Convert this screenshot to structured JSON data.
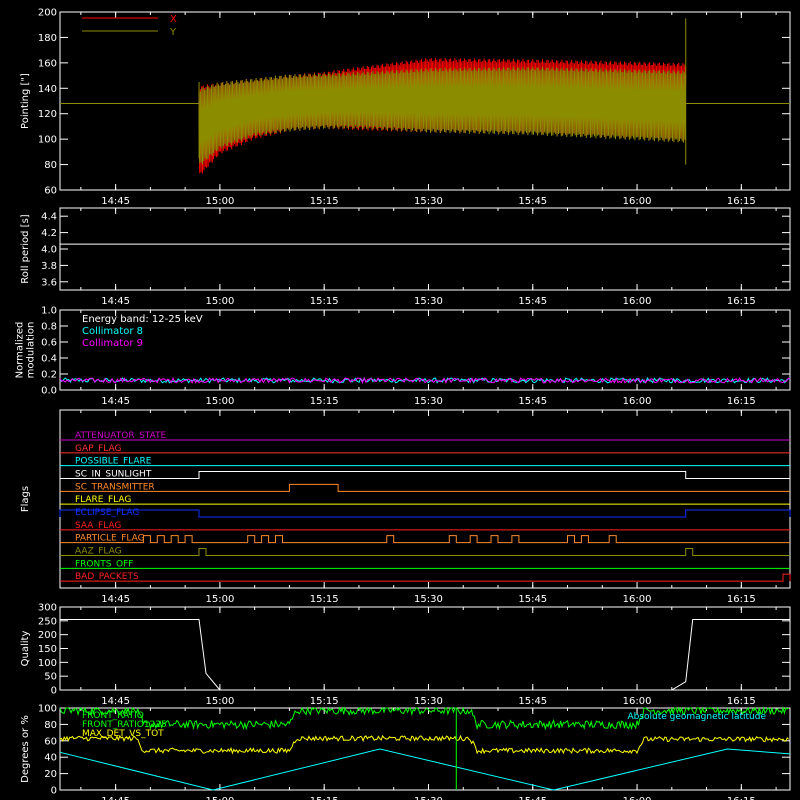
{
  "time_ticks": [
    "14:45",
    "15:00",
    "15:15",
    "15:30",
    "15:45",
    "16:00",
    "16:15"
  ],
  "colors": {
    "bg": "#000000",
    "axis": "#ffffff"
  },
  "chart_data": [
    {
      "id": "pointing",
      "type": "line",
      "ylabel": "Pointing [\"]",
      "ylim": [
        60,
        200
      ],
      "yticks": [
        "60",
        "80",
        "100",
        "120",
        "140",
        "160",
        "180",
        "200"
      ],
      "xlim": [
        "14:37",
        "16:22"
      ],
      "legend": [
        {
          "name": "X",
          "color": "#ff0000"
        },
        {
          "name": "Y",
          "color": "#8c8c00"
        }
      ],
      "baseline_value": 128,
      "active_interval": [
        "14:57",
        "16:07"
      ],
      "series": [
        {
          "name": "X",
          "color": "#ff0000",
          "x": [
            "14:57",
            "15:00",
            "15:05",
            "15:10",
            "15:15",
            "15:20",
            "15:30",
            "15:45",
            "16:00",
            "16:07"
          ],
          "upper": [
            142,
            145,
            148,
            151,
            153,
            157,
            164,
            163,
            161,
            160
          ],
          "lower": [
            70,
            88,
            100,
            106,
            108,
            107,
            105,
            104,
            100,
            98
          ]
        },
        {
          "name": "Y",
          "color": "#8c8c00",
          "x": [
            "14:57",
            "15:00",
            "15:05",
            "15:10",
            "15:15",
            "15:20",
            "15:30",
            "15:45",
            "16:00",
            "16:07"
          ],
          "upper": [
            140,
            145,
            148,
            151,
            152,
            153,
            156,
            157,
            155,
            154
          ],
          "lower": [
            78,
            92,
            102,
            106,
            108,
            108,
            105,
            103,
            99,
            97
          ]
        }
      ]
    },
    {
      "id": "roll",
      "type": "line",
      "ylabel": "Roll period [s]",
      "ylim": [
        3.5,
        4.5
      ],
      "yticks": [
        "3.6",
        "3.8",
        "4.0",
        "4.2",
        "4.4"
      ],
      "series": [
        {
          "name": "roll period",
          "color": "#ffffff",
          "x": [
            "14:37",
            "16:22"
          ],
          "values": [
            4.06,
            4.06
          ]
        }
      ]
    },
    {
      "id": "modulation",
      "type": "line",
      "ylabel": "Normalized modulation",
      "ylim": [
        0,
        1
      ],
      "yticks": [
        "0.0",
        "0.2",
        "0.4",
        "0.6",
        "0.8",
        "1.0"
      ],
      "legend": [
        {
          "name": "Energy band: 12-25 keV",
          "color": "#ffffff"
        },
        {
          "name": "Collimator 8",
          "color": "#00ffff"
        },
        {
          "name": "Collimator 9",
          "color": "#ff00ff"
        }
      ],
      "series": [
        {
          "name": "Collimator 8",
          "color": "#00ffff",
          "mean": 0.12
        },
        {
          "name": "Collimator 9",
          "color": "#ff00ff",
          "mean": 0.12
        }
      ]
    },
    {
      "id": "flags",
      "type": "line",
      "ylabel": "Flags",
      "flags": [
        {
          "name": "ATTENUATOR_STATE",
          "color": "#cc00cc",
          "on": []
        },
        {
          "name": "GAP_FLAG",
          "color": "#ff3030",
          "on": []
        },
        {
          "name": "POSSIBLE_FLARE",
          "color": "#00ffff",
          "on": []
        },
        {
          "name": "SC_IN_SUNLIGHT",
          "color": "#ffffff",
          "on": [
            [
              "14:57",
              "16:07"
            ]
          ]
        },
        {
          "name": "SC_TRANSMITTER",
          "color": "#ff8a2a",
          "on": [
            [
              "15:10",
              "15:17"
            ]
          ]
        },
        {
          "name": "FLARE_FLAG",
          "color": "#ffff00",
          "on": []
        },
        {
          "name": "ECLIPSE_FLAG",
          "color": "#1030ff",
          "on": [
            [
              "14:37",
              "14:57"
            ],
            [
              "16:07",
              "16:22"
            ]
          ]
        },
        {
          "name": "SAA_FLAG",
          "color": "#ff2020",
          "on": []
        },
        {
          "name": "PARTICLE_FLAG",
          "color": "#ff8a2a",
          "on": [
            [
              "14:49",
              "14:50"
            ],
            [
              "14:51",
              "14:52"
            ],
            [
              "14:53",
              "14:54"
            ],
            [
              "14:55",
              "14:56"
            ],
            [
              "15:04",
              "15:05"
            ],
            [
              "15:06",
              "15:07"
            ],
            [
              "15:08",
              "15:09"
            ],
            [
              "15:24",
              "15:25"
            ],
            [
              "15:33",
              "15:34"
            ],
            [
              "15:36",
              "15:37"
            ],
            [
              "15:39",
              "15:40"
            ],
            [
              "15:42",
              "15:43"
            ],
            [
              "15:50",
              "15:51"
            ],
            [
              "15:52",
              "15:53"
            ],
            [
              "15:56",
              "15:57"
            ]
          ]
        },
        {
          "name": "AAZ_FLAG",
          "color": "#8c8c00",
          "on": [
            [
              "14:57",
              "14:58"
            ],
            [
              "16:07",
              "16:08"
            ]
          ]
        },
        {
          "name": "FRONTS_OFF",
          "color": "#00ff00",
          "on": []
        },
        {
          "name": "BAD_PACKETS",
          "color": "#ff2020",
          "on": [
            [
              "16:21",
              "16:22"
            ]
          ]
        }
      ]
    },
    {
      "id": "quality",
      "type": "line",
      "ylabel": "Quality",
      "ylim": [
        0,
        300
      ],
      "yticks": [
        "0",
        "50",
        "100",
        "150",
        "200",
        "250",
        "300"
      ],
      "series": [
        {
          "name": "quality",
          "color": "#ffffff",
          "x": [
            "14:37",
            "14:57",
            "14:58",
            "15:00",
            "16:05",
            "16:07",
            "16:08",
            "16:22"
          ],
          "values": [
            255,
            255,
            60,
            0,
            0,
            30,
            255,
            255
          ]
        }
      ]
    },
    {
      "id": "ratios",
      "type": "line",
      "ylabel": "Degrees or %",
      "ylim": [
        0,
        100
      ],
      "yticks": [
        "0",
        "20",
        "40",
        "60",
        "80",
        "100"
      ],
      "legend": [
        {
          "name": "FRONT_RATIO",
          "color": "#00ff00"
        },
        {
          "name": "FRONT_RATIO1225",
          "color": "#00ff00"
        },
        {
          "name": "MAX_DET_VS_TOT",
          "color": "#ffff00"
        },
        {
          "name": "Absolute geomagnetic latitude",
          "color": "#00ffff"
        }
      ],
      "series": [
        {
          "name": "FRONT_RATIO",
          "color": "#00ff00",
          "x": [
            "14:37",
            "14:48",
            "14:49",
            "15:10",
            "15:11",
            "15:36",
            "15:37",
            "16:00",
            "16:01",
            "16:22"
          ],
          "values": [
            97,
            97,
            80,
            80,
            97,
            97,
            80,
            80,
            97,
            97
          ]
        },
        {
          "name": "MAX_DET_VS_TOT",
          "color": "#ffff00",
          "x": [
            "14:37",
            "14:48",
            "14:49",
            "15:10",
            "15:11",
            "15:36",
            "15:37",
            "16:00",
            "16:01",
            "16:22"
          ],
          "values": [
            63,
            63,
            48,
            48,
            63,
            63,
            48,
            48,
            62,
            62
          ]
        },
        {
          "name": "Absolute geomagnetic latitude",
          "color": "#00ffff",
          "x": [
            "14:37",
            "14:59",
            "15:23",
            "15:48",
            "16:13",
            "16:22"
          ],
          "values": [
            46,
            0,
            50,
            0,
            50,
            44
          ]
        }
      ]
    }
  ]
}
